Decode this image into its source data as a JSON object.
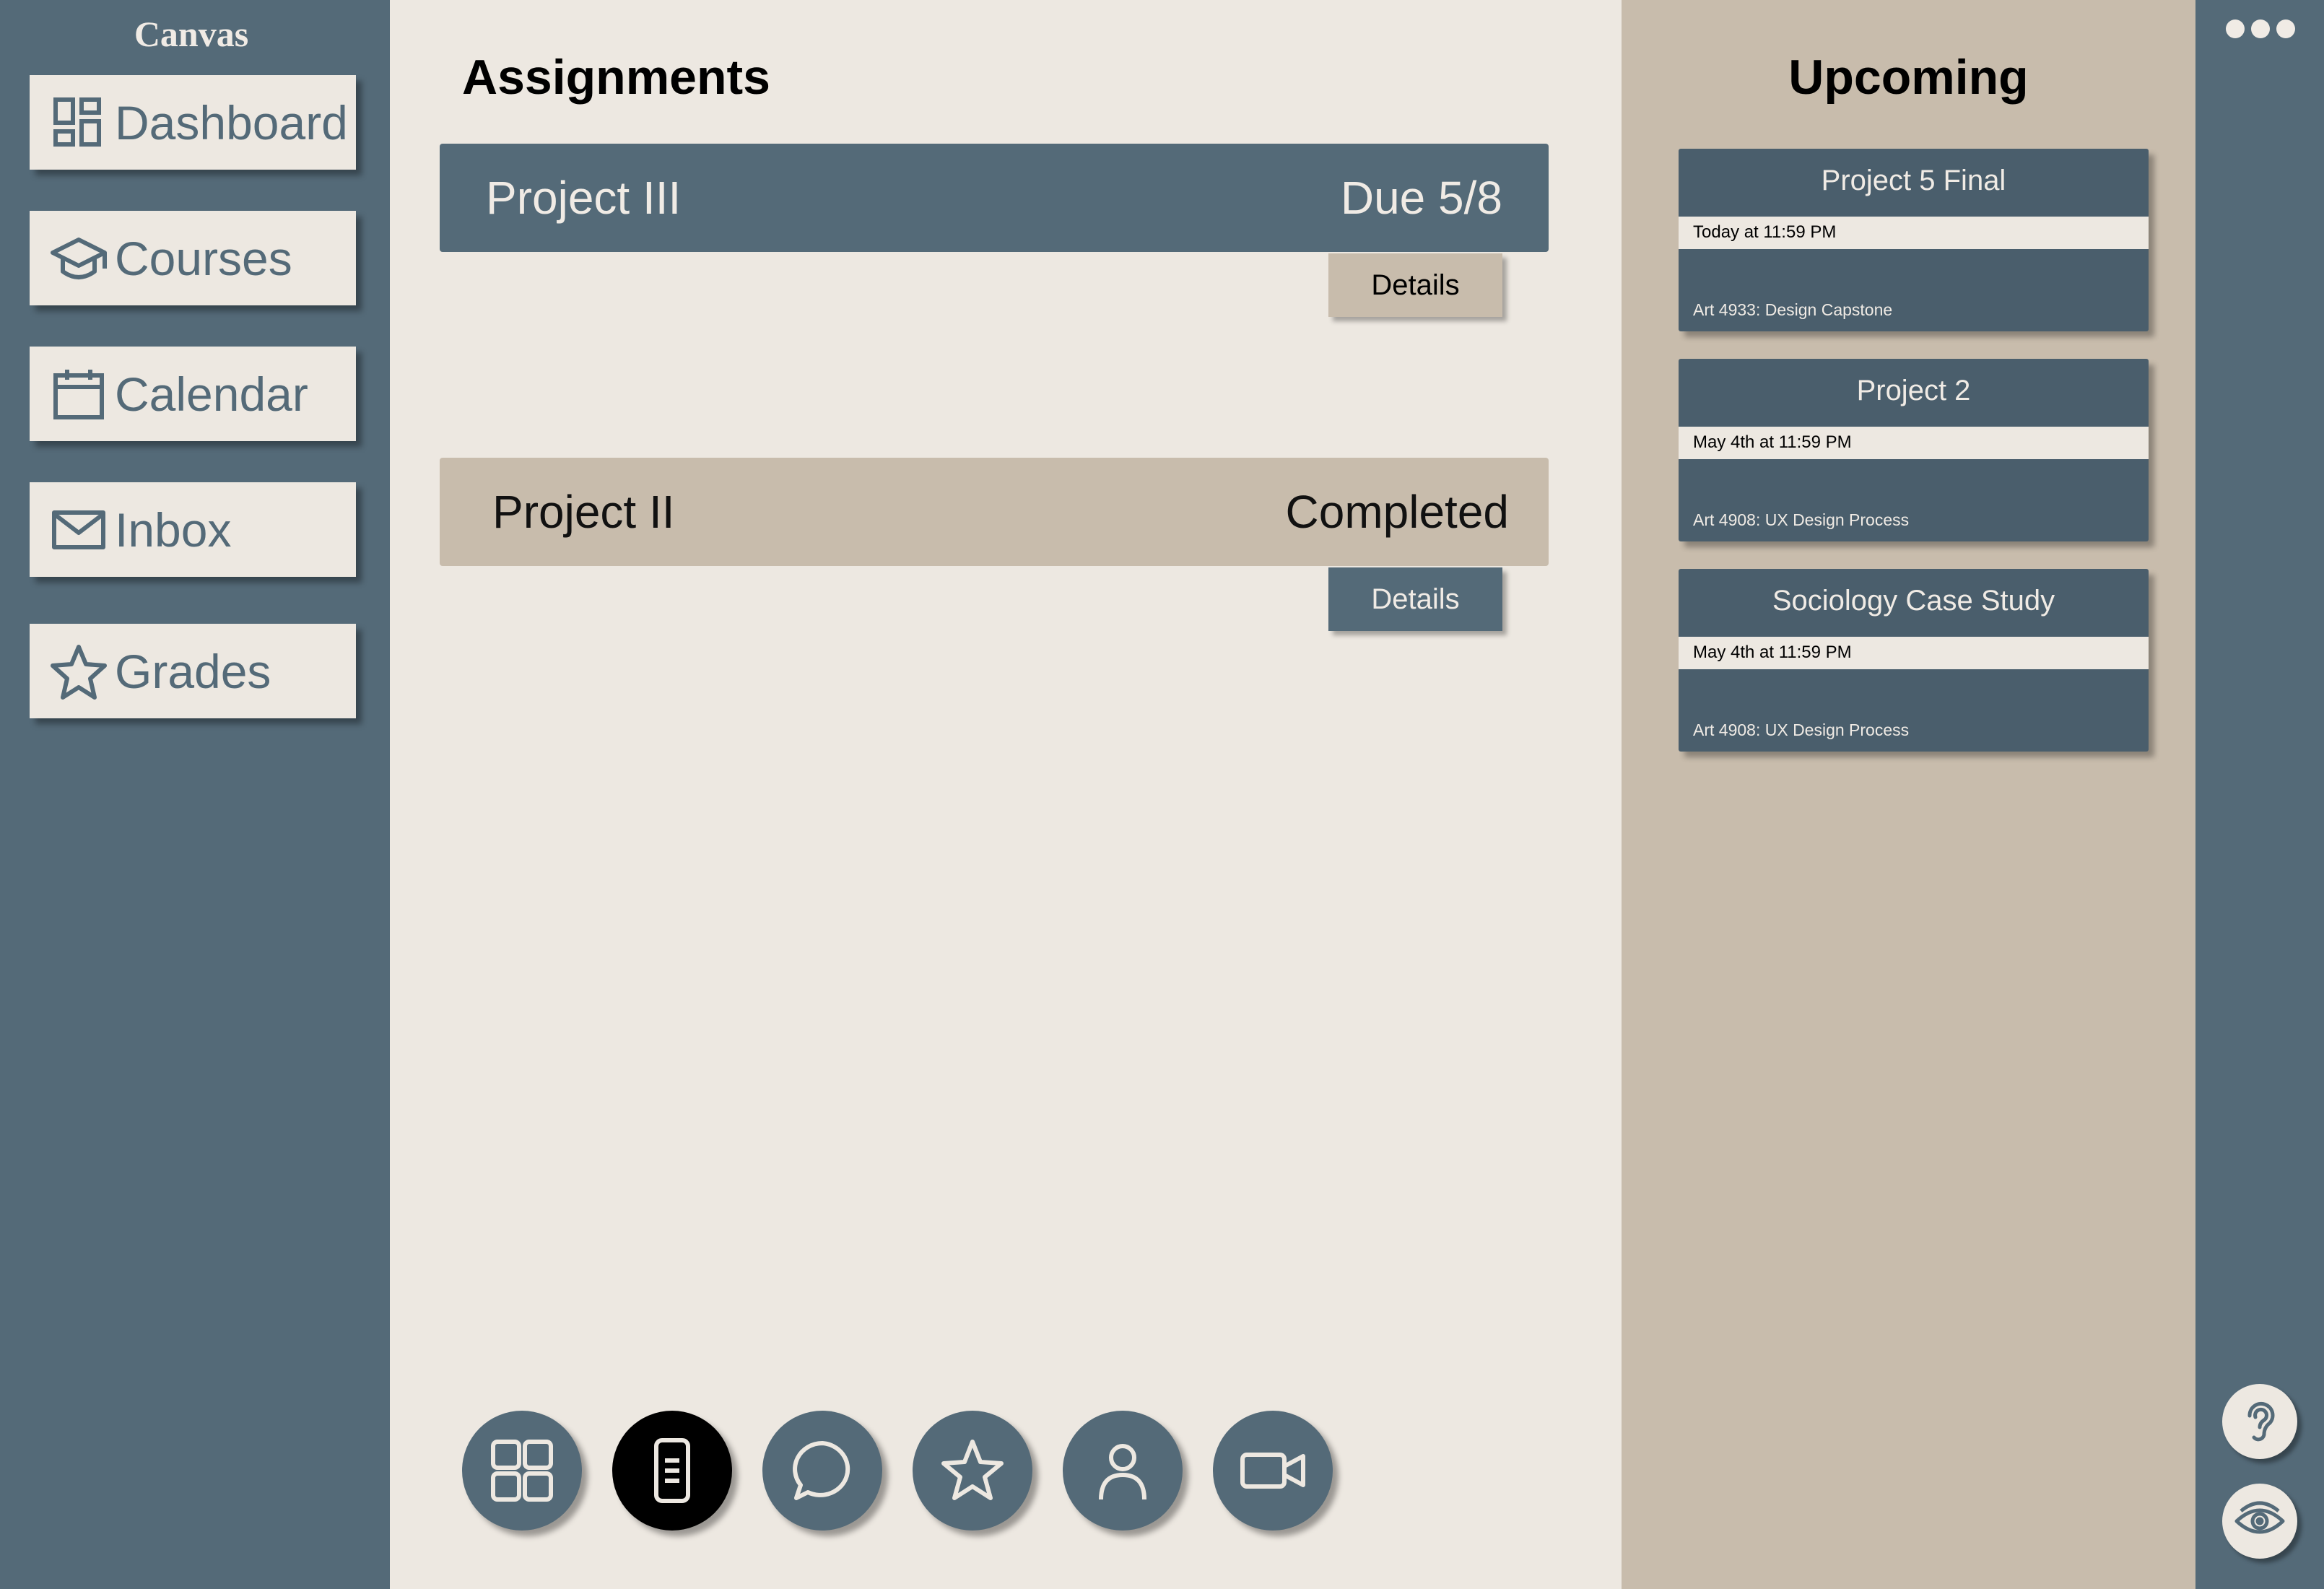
{
  "app": {
    "brand": "Canvas"
  },
  "sidebar": {
    "items": [
      {
        "label": "Dashboard",
        "icon": "dashboard-icon"
      },
      {
        "label": "Courses",
        "icon": "graduation-cap-icon"
      },
      {
        "label": "Calendar",
        "icon": "calendar-icon"
      },
      {
        "label": "Inbox",
        "icon": "mail-icon"
      },
      {
        "label": "Grades",
        "icon": "star-icon"
      }
    ]
  },
  "main": {
    "title": "Assignments",
    "assignments": [
      {
        "name": "Project III",
        "status": "Due 5/8",
        "details_label": "Details"
      },
      {
        "name": "Project II",
        "status": "Completed",
        "details_label": "Details"
      }
    ],
    "bottom_nav": [
      {
        "icon": "grid-icon",
        "active": false
      },
      {
        "icon": "document-icon",
        "active": true
      },
      {
        "icon": "chat-icon",
        "active": false
      },
      {
        "icon": "star-icon",
        "active": false
      },
      {
        "icon": "person-icon",
        "active": false
      },
      {
        "icon": "video-icon",
        "active": false
      }
    ]
  },
  "upcoming": {
    "title": "Upcoming",
    "cards": [
      {
        "title": "Project 5 Final",
        "due": "Today at 11:59 PM",
        "course": "Art 4933: Design Capstone"
      },
      {
        "title": "Project 2",
        "due": "May 4th at 11:59 PM",
        "course": "Art 4908: UX Design Process"
      },
      {
        "title": "Sociology Case Study",
        "due": "May 4th at 11:59 PM",
        "course": "Art 4908: UX Design Process"
      }
    ]
  },
  "right_rail": {
    "menu_icon": "more-dots-icon",
    "accessibility": [
      "hearing-icon",
      "vision-icon"
    ]
  },
  "colors": {
    "slate": "#546a78",
    "cream": "#ede8e1",
    "tan": "#c8bcac",
    "card": "#4a5e6c"
  }
}
